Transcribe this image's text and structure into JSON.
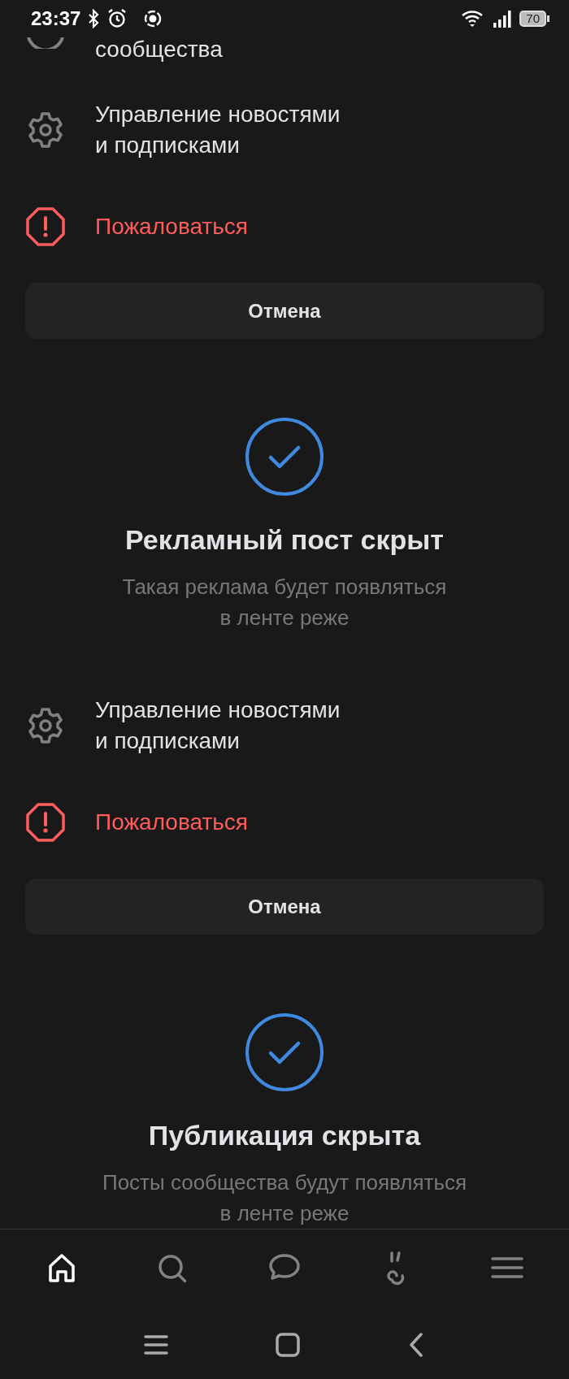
{
  "status_bar": {
    "time": "23:37",
    "battery": "70"
  },
  "sections": [
    {
      "actions": [
        {
          "kind": "partial",
          "label": "сообщества"
        },
        {
          "kind": "settings",
          "label": "Управление новостями\nи подписками"
        },
        {
          "kind": "report",
          "label": "Пожаловаться"
        }
      ],
      "cancel": "Отмена"
    },
    {
      "status": {
        "title": "Рекламный пост скрыт",
        "subtitle": "Такая реклама будет появляться\nв ленте реже"
      },
      "actions": [
        {
          "kind": "settings",
          "label": "Управление новостями\nи подписками"
        },
        {
          "kind": "report",
          "label": "Пожаловаться"
        }
      ],
      "cancel": "Отмена"
    },
    {
      "status": {
        "title": "Публикация скрыта",
        "subtitle": "Посты сообщества будут появляться\nв ленте реже"
      }
    }
  ],
  "tab_bar": [
    {
      "kind": "home",
      "selected": true
    },
    {
      "kind": "search",
      "selected": false
    },
    {
      "kind": "messages",
      "selected": false
    },
    {
      "kind": "clips",
      "selected": false
    },
    {
      "kind": "menu",
      "selected": false
    }
  ]
}
